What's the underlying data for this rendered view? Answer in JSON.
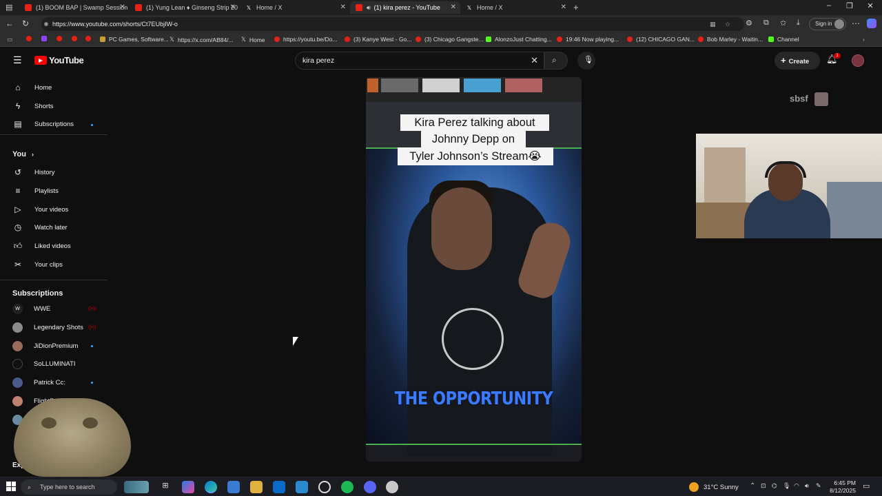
{
  "browser": {
    "tabs": [
      {
        "title": "(1) BOOM BAP | Swamp Session",
        "favicon": "youtube-icon"
      },
      {
        "title": "(1) Yung Lean ♦ Ginseng Strip 20",
        "favicon": "youtube-icon"
      },
      {
        "title": "Home / X",
        "favicon": "x-icon"
      },
      {
        "title": "(1) kira perez - YouTube",
        "favicon": "youtube-icon",
        "active": true
      },
      {
        "title": "Home / X",
        "favicon": "x-icon"
      }
    ],
    "url": "https://www.youtube.com/shorts/Ct7EUbjIW-o",
    "signin_label": "Sign in",
    "bookmarks": [
      "PC Games, Software...",
      "https://x.com/AB84/...",
      "Home",
      "https://youtu.be/Do...",
      "(3) Kanye West - Go...",
      "(3) Chicago Gangste...",
      "AlonzoJust Chatting...",
      "19:46 Now playing...",
      "(12) CHICAGO GAN...",
      "Bob Marley - Waitin...",
      "Channel"
    ]
  },
  "youtube": {
    "logo_text": "YouTube",
    "search_value": "kira perez",
    "create_label": "Create",
    "notification_count": "1",
    "nav_main": [
      "Home",
      "Shorts",
      "Subscriptions"
    ],
    "you_header": "You",
    "nav_you": [
      "History",
      "Playlists",
      "Your videos",
      "Watch later",
      "Liked videos",
      "Your clips"
    ],
    "subscriptions_header": "Subscriptions",
    "subscriptions": [
      "WWE",
      "Legendary Shots",
      "JiDionPremium",
      "SoLLUMINATI",
      "Patrick Cc:",
      "FlightRe"
    ],
    "explore_partial": "Expl",
    "short": {
      "caption_lines": [
        "Kira Perez talking about",
        "Johnny Depp on",
        "Tyler Johnson’s Stream😭"
      ],
      "overlay_text": "THE OPPORTUNITY"
    }
  },
  "overlay": {
    "streamer_label": "sbsf"
  },
  "taskbar": {
    "search_placeholder": "Type here to search",
    "weather": "31°C  Sunny",
    "time": "6:45 PM",
    "date": "8/12/2025"
  }
}
